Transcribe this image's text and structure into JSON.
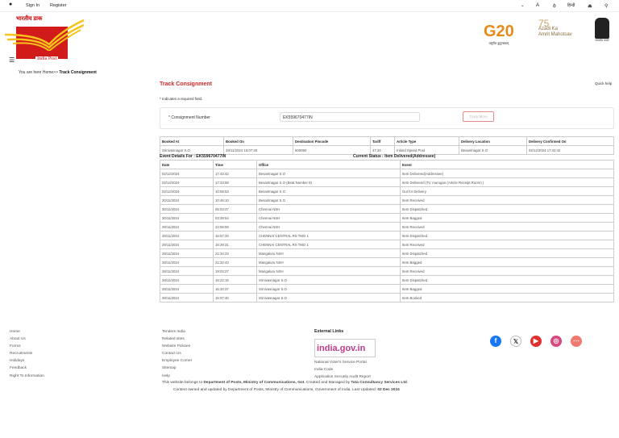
{
  "topbar": {
    "sign_in": "Sign In",
    "register": "Register",
    "hindi": "हिन्दी"
  },
  "logo": {
    "hindi": "भारतीय डाक",
    "english": "India Post"
  },
  "header_logos": {
    "g20": "G20",
    "g20_sub": "वसुधैव कुटुम्बकम्",
    "azadi_line1": "75",
    "azadi_line2": "Azadi Ka",
    "azadi_line3": "Amrit Mahotsav",
    "emblem_caption": "सत्यमेव जयते"
  },
  "breadcrumb": {
    "prefix": "You are here Home>> ",
    "current": "Track Consignment"
  },
  "page": {
    "title": "Track Consignment",
    "quick_help": "Quick help",
    "required_note": "* Indicates a required field."
  },
  "form": {
    "label": "* Consignment Number",
    "value": "EK559670477IN",
    "button": "Track More"
  },
  "summary": {
    "headers": [
      "Booked At",
      "Booked On",
      "Destination Pincode",
      "Tariff",
      "Article Type",
      "Delivery Location",
      "Delivery Confirmed On"
    ],
    "row": [
      "Srinivasnagar S.O",
      "28/11/2024 15:07:40",
      "600090",
      "47.20",
      "Inland Speed Post",
      "Besantnagar S.O",
      "02/12/2024 17:43:42"
    ]
  },
  "events": {
    "title": "Event Details For : EK559670477IN",
    "status": "Current Status : Item Delivered(Addressee)",
    "headers": [
      "Date",
      "Time",
      "Office",
      "Event"
    ],
    "rows": [
      [
        "02/12/2024",
        "17:43:42",
        "Besantnagar S.O",
        "Item Delivered(Addressee)"
      ],
      [
        "02/12/2024",
        "17:33:58",
        "Besantnagar S.O (Beat Number 8)",
        "Item Delivered (To: murugan (Article Receipt Room) )"
      ],
      [
        "02/12/2024",
        "10:59:53",
        "Besantnagar S.O",
        "Out for Delivery"
      ],
      [
        "30/11/2024",
        "10:46:10",
        "Besantnagar S.O",
        "Item Received"
      ],
      [
        "30/11/2024",
        "05:03:47",
        "Chennai NSH",
        "Item Dispatched"
      ],
      [
        "30/11/2024",
        "03:39:54",
        "Chennai NSH",
        "Item Bagged"
      ],
      [
        "29/11/2024",
        "22:58:59",
        "Chennai NSH",
        "Item Received"
      ],
      [
        "29/11/2024",
        "16:57:34",
        "CHENNAI CENTRAL RS TMO 1",
        "Item Dispatched"
      ],
      [
        "29/11/2024",
        "16:39:31",
        "CHENNAI CENTRAL RS TMO 1",
        "Item Received"
      ],
      [
        "28/11/2024",
        "21:34:23",
        "Mangaluru NSH",
        "Item Dispatched"
      ],
      [
        "28/11/2024",
        "21:32:43",
        "Mangaluru NSH",
        "Item Bagged"
      ],
      [
        "28/11/2024",
        "19:03:27",
        "Mangaluru NSH",
        "Item Received"
      ],
      [
        "28/11/2024",
        "16:22:15",
        "Srinivasnagar S.O",
        "Item Dispatched"
      ],
      [
        "28/11/2024",
        "16:20:37",
        "Srinivasnagar S.O",
        "Item Bagged"
      ],
      [
        "28/11/2024",
        "15:07:40",
        "Srinivasnagar S.O",
        "Item Booked"
      ]
    ]
  },
  "footer": {
    "col1": [
      "Home",
      "About Us",
      "Forms",
      "Recruitments",
      "Holidays",
      "Feedback",
      "Right To Information"
    ],
    "col2": [
      "Tenders India",
      "Related sites",
      "Website Policies",
      "Contact Us",
      "Employee Corner",
      "Sitemap",
      "Help"
    ],
    "external_title": "External Links",
    "india_gov": "india.gov.in",
    "external": [
      "National Voter's Service Portal",
      "India Code",
      "Application Security Audit Report"
    ],
    "owner_prefix": "This website belongs to ",
    "owner_bold": "Department of Posts, Ministry of Communications, GoI.",
    "owner_mid": " Created and Managed by ",
    "owner_tcs": "Tata Consultancy Services Ltd",
    "content_text": "Content owned and updated by Department of Posts, Ministry of Communications, Government of India. Last Updated: ",
    "updated": "02 Dec 2024"
  },
  "social": [
    {
      "name": "facebook",
      "glyph": "f",
      "color": "#1877f2"
    },
    {
      "name": "x",
      "glyph": "𝕏",
      "color": "#ffffff"
    },
    {
      "name": "youtube",
      "glyph": "▶",
      "color": "#e02f2f"
    },
    {
      "name": "instagram",
      "glyph": "◎",
      "color": "#d6497e"
    },
    {
      "name": "more",
      "glyph": "⋯",
      "color": "#f07a72"
    }
  ]
}
